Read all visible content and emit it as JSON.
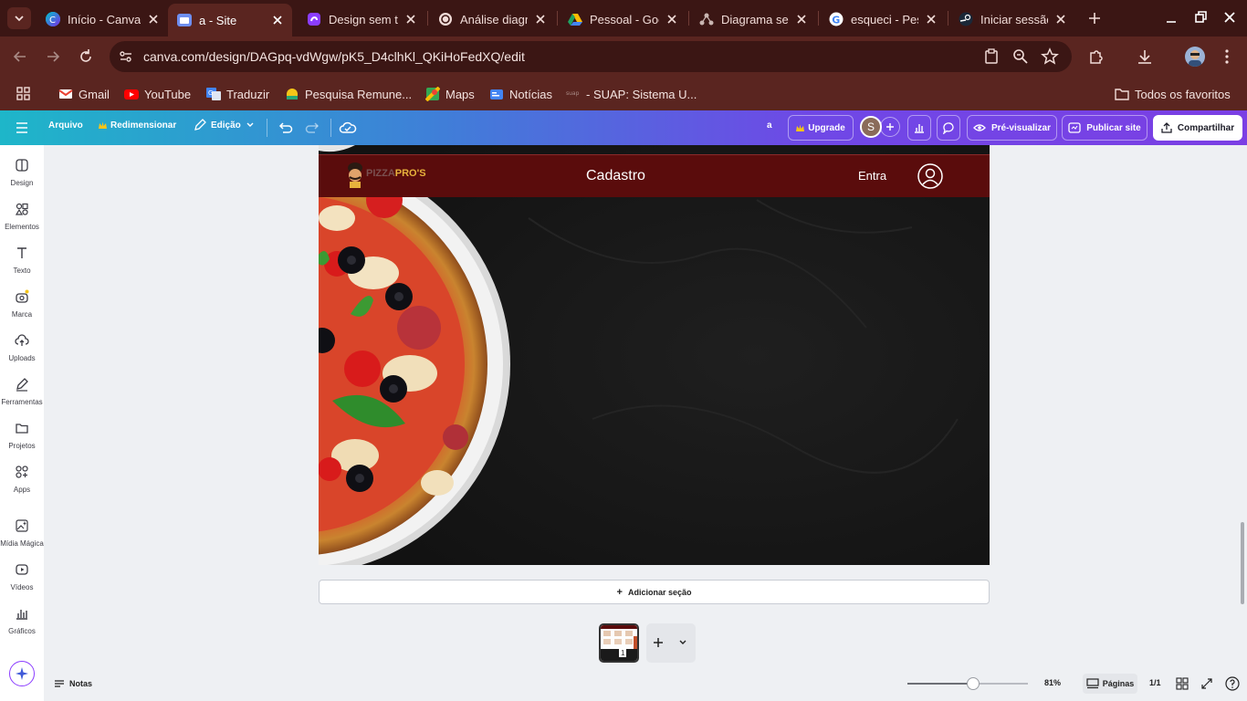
{
  "browser": {
    "tabs": [
      {
        "title": "Início - Canva",
        "favicon": "canva-icon",
        "active": false
      },
      {
        "title": "a - Site",
        "favicon": "canva-site-icon",
        "active": true
      },
      {
        "title": "Design sem título",
        "favicon": "canva-design-icon",
        "active": false
      },
      {
        "title": "Análise diagrama",
        "favicon": "openai-icon",
        "active": false
      },
      {
        "title": "Pessoal - Google Drive",
        "favicon": "google-drive-icon",
        "active": false
      },
      {
        "title": "Diagrama sem título",
        "favicon": "diagram-icon",
        "active": false
      },
      {
        "title": "esqueci - Pesquisa Google",
        "favicon": "google-icon",
        "active": false
      },
      {
        "title": "Iniciar sessão",
        "favicon": "steam-icon",
        "active": false
      }
    ],
    "url": "canva.com/design/DAGpq-vdWgw/pK5_D4clhKl_QKiHoFedXQ/edit",
    "bookmarks": [
      {
        "label": "Gmail",
        "icon": "gmail-icon"
      },
      {
        "label": "YouTube",
        "icon": "youtube-icon"
      },
      {
        "label": "Traduzir",
        "icon": "translate-icon"
      },
      {
        "label": "Pesquisa Remune...",
        "icon": "pesquisa-icon"
      },
      {
        "label": "Maps",
        "icon": "maps-icon"
      },
      {
        "label": "Notícias",
        "icon": "news-icon"
      },
      {
        "label": "- SUAP: Sistema U...",
        "icon": "suap-icon"
      }
    ],
    "all_bookmarks": "Todos os favoritos"
  },
  "canva_toolbar": {
    "file": "Arquivo",
    "resize": "Redimensionar",
    "edit": "Edição",
    "design_name": "a",
    "upgrade": "Upgrade",
    "avatar_letter": "S",
    "preview": "Pré-visualizar",
    "publish": "Publicar site",
    "share": "Compartilhar"
  },
  "rail": [
    {
      "label": "Design",
      "icon": "design-icon"
    },
    {
      "label": "Elementos",
      "icon": "elements-icon"
    },
    {
      "label": "Texto",
      "icon": "text-icon"
    },
    {
      "label": "Marca",
      "icon": "brand-icon"
    },
    {
      "label": "Uploads",
      "icon": "upload-icon"
    },
    {
      "label": "Ferramentas",
      "icon": "tools-icon"
    },
    {
      "label": "Projetos",
      "icon": "folder-icon"
    },
    {
      "label": "Apps",
      "icon": "apps-icon"
    },
    {
      "label": "Mídia Mágica",
      "icon": "magic-media-icon"
    },
    {
      "label": "Vídeos",
      "icon": "video-icon"
    },
    {
      "label": "Gráficos",
      "icon": "charts-icon"
    }
  ],
  "page": {
    "logo_prefix": "PIZZA",
    "logo_suffix": "PRO'S",
    "title": "Cadastro",
    "login_link": "Entra"
  },
  "canvas": {
    "add_section": "Adicionar seção",
    "page_number": "1"
  },
  "footer": {
    "notes": "Notas",
    "zoom": "81%",
    "zoom_fraction": 0.55,
    "pages": "Páginas",
    "page_count": "1/1"
  }
}
